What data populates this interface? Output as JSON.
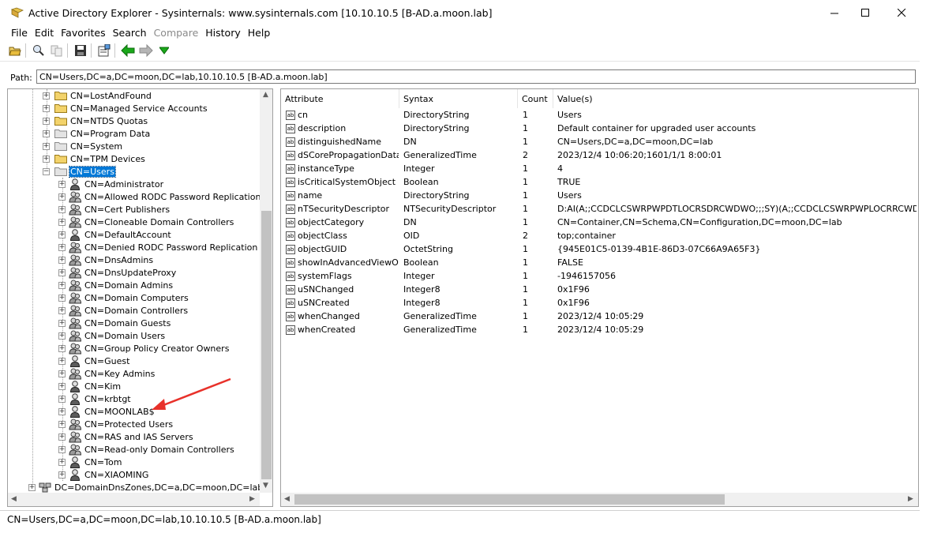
{
  "window": {
    "title": "Active Directory Explorer - Sysinternals: www.sysinternals.com [10.10.10.5 [B-AD.a.moon.lab]",
    "minimize": "—",
    "maximize": "☐",
    "close": "✕"
  },
  "menu": {
    "file": "File",
    "edit": "Edit",
    "favorites": "Favorites",
    "search": "Search",
    "compare": "Compare",
    "history": "History",
    "help": "Help"
  },
  "toolbar": {
    "icons": [
      "open-icon",
      "search-icon",
      "compare-icon",
      "save-icon",
      "properties-icon",
      "back-icon",
      "forward-icon",
      "dropdown-icon"
    ]
  },
  "path": {
    "label": "Path:",
    "value": "CN=Users,DC=a,DC=moon,DC=lab,10.10.10.5 [B-AD.a.moon.lab]"
  },
  "tree": {
    "containers": [
      {
        "label": "CN=LostAndFound",
        "icon": "folder-yellow"
      },
      {
        "label": "CN=Managed Service Accounts",
        "icon": "folder-yellow"
      },
      {
        "label": "CN=NTDS Quotas",
        "icon": "folder-yellow"
      },
      {
        "label": "CN=Program Data",
        "icon": "folder-gray"
      },
      {
        "label": "CN=System",
        "icon": "folder-gray"
      },
      {
        "label": "CN=TPM Devices",
        "icon": "folder-yellow"
      },
      {
        "label": "CN=Users",
        "icon": "folder-gray",
        "selected": true
      }
    ],
    "children": [
      {
        "label": "CN=Administrator",
        "icon": "user-icon"
      },
      {
        "label": "CN=Allowed RODC Password Replication Group",
        "icon": "group-icon"
      },
      {
        "label": "CN=Cert Publishers",
        "icon": "group-icon"
      },
      {
        "label": "CN=Cloneable Domain Controllers",
        "icon": "group-icon"
      },
      {
        "label": "CN=DefaultAccount",
        "icon": "user-icon"
      },
      {
        "label": "CN=Denied RODC Password Replication Group",
        "icon": "group-icon"
      },
      {
        "label": "CN=DnsAdmins",
        "icon": "group-icon"
      },
      {
        "label": "CN=DnsUpdateProxy",
        "icon": "group-icon"
      },
      {
        "label": "CN=Domain Admins",
        "icon": "group-icon"
      },
      {
        "label": "CN=Domain Computers",
        "icon": "group-icon"
      },
      {
        "label": "CN=Domain Controllers",
        "icon": "group-icon"
      },
      {
        "label": "CN=Domain Guests",
        "icon": "group-icon"
      },
      {
        "label": "CN=Domain Users",
        "icon": "group-icon"
      },
      {
        "label": "CN=Group Policy Creator Owners",
        "icon": "group-icon"
      },
      {
        "label": "CN=Guest",
        "icon": "user-icon"
      },
      {
        "label": "CN=Key Admins",
        "icon": "group-icon"
      },
      {
        "label": "CN=Kim",
        "icon": "user-icon"
      },
      {
        "label": "CN=krbtgt",
        "icon": "user-icon"
      },
      {
        "label": "CN=MOONLAB$",
        "icon": "user-icon"
      },
      {
        "label": "CN=Protected Users",
        "icon": "group-icon"
      },
      {
        "label": "CN=RAS and IAS Servers",
        "icon": "group-icon"
      },
      {
        "label": "CN=Read-only Domain Controllers",
        "icon": "group-icon"
      },
      {
        "label": "CN=Tom",
        "icon": "user-icon"
      },
      {
        "label": "CN=XIAOMING",
        "icon": "user-icon"
      }
    ],
    "bottom": {
      "label": "DC=DomainDnsZones,DC=a,DC=moon,DC=lab",
      "icon": "domain-icon"
    }
  },
  "attributes": {
    "columns": [
      "Attribute",
      "Syntax",
      "Count",
      "Value(s)"
    ],
    "rows": [
      [
        "cn",
        "DirectoryString",
        "1",
        "Users"
      ],
      [
        "description",
        "DirectoryString",
        "1",
        "Default container for upgraded user accounts"
      ],
      [
        "distinguishedName",
        "DN",
        "1",
        "CN=Users,DC=a,DC=moon,DC=lab"
      ],
      [
        "dSCorePropagationData",
        "GeneralizedTime",
        "2",
        "2023/12/4 10:06:20;1601/1/1 8:00:01"
      ],
      [
        "instanceType",
        "Integer",
        "1",
        "4"
      ],
      [
        "isCriticalSystemObject",
        "Boolean",
        "1",
        "TRUE"
      ],
      [
        "name",
        "DirectoryString",
        "1",
        "Users"
      ],
      [
        "nTSecurityDescriptor",
        "NTSecurityDescriptor",
        "1",
        "D:AI(A;;CCDCLCSWRPWPDTLOCRSDRCWDWO;;;SY)(A;;CCDCLCSWRPWPLOCRRCWDWO;;;S-"
      ],
      [
        "objectCategory",
        "DN",
        "1",
        "CN=Container,CN=Schema,CN=Configuration,DC=moon,DC=lab"
      ],
      [
        "objectClass",
        "OID",
        "2",
        "top;container"
      ],
      [
        "objectGUID",
        "OctetString",
        "1",
        "{945E01C5-0139-4B1E-86D3-07C66A9A65F3}"
      ],
      [
        "showInAdvancedViewO...",
        "Boolean",
        "1",
        "FALSE"
      ],
      [
        "systemFlags",
        "Integer",
        "1",
        "-1946157056"
      ],
      [
        "uSNChanged",
        "Integer8",
        "1",
        "0x1F96"
      ],
      [
        "uSNCreated",
        "Integer8",
        "1",
        "0x1F96"
      ],
      [
        "whenChanged",
        "GeneralizedTime",
        "1",
        "2023/12/4 10:05:29"
      ],
      [
        "whenCreated",
        "GeneralizedTime",
        "1",
        "2023/12/4 10:05:29"
      ]
    ]
  },
  "status": {
    "text": "CN=Users,DC=a,DC=moon,DC=lab,10.10.10.5 [B-AD.a.moon.lab]"
  },
  "colors": {
    "selection": "#0078d7",
    "annotation_arrow": "#e8312a",
    "folder_yellow": "#f3d36b",
    "back_arrow": "#1aa81a"
  }
}
